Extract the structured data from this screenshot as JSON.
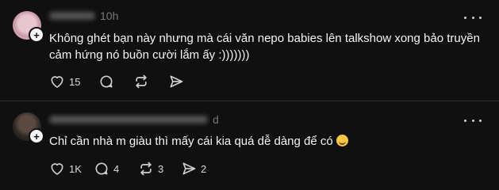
{
  "posts": [
    {
      "timestamp": "10h",
      "text": "Không ghét bạn này nhưng mà cái văn nepo babies lên talkshow xong bảo truyền cảm hứng nó buồn cười lắm ấy :)))))))",
      "likes": "15",
      "replies": "",
      "reposts": "",
      "shares": ""
    },
    {
      "timestamp": "d",
      "text": "Chỉ cần nhà m giàu thì mấy cái kia quá dễ dàng để có",
      "emoji": "smiling-face-emoji",
      "likes": "1K",
      "replies": "4",
      "reposts": "3",
      "shares": "2"
    }
  ],
  "icons": {
    "follow": "plus-icon",
    "more": "more-horizontal-icon",
    "like": "heart-icon",
    "reply": "comment-icon",
    "repost": "repost-icon",
    "share": "send-icon"
  },
  "colors": {
    "background": "#101010",
    "text": "#f3f5f7",
    "muted": "#777777",
    "divider": "#2d2d2d"
  }
}
